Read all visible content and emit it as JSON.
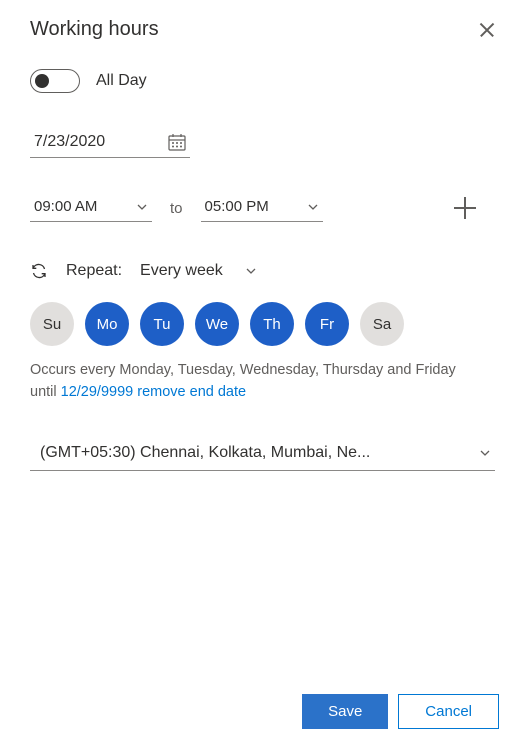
{
  "title": "Working hours",
  "allDay": {
    "label": "All Day",
    "on": false
  },
  "date": "7/23/2020",
  "time": {
    "from": "09:00 AM",
    "to_label": "to",
    "to": "05:00 PM"
  },
  "repeat": {
    "label": "Repeat:",
    "value": "Every week"
  },
  "days": [
    {
      "abbr": "Su",
      "active": false
    },
    {
      "abbr": "Mo",
      "active": true
    },
    {
      "abbr": "Tu",
      "active": true
    },
    {
      "abbr": "We",
      "active": true
    },
    {
      "abbr": "Th",
      "active": true
    },
    {
      "abbr": "Fr",
      "active": true
    },
    {
      "abbr": "Sa",
      "active": false
    }
  ],
  "occursText": "Occurs every Monday, Tuesday, Wednesday, Thursday and Friday",
  "until": {
    "prefix": "until",
    "date": "12/29/9999",
    "remove_label": "remove end date"
  },
  "timezone": "(GMT+05:30) Chennai, Kolkata, Mumbai, Ne...",
  "buttons": {
    "save": "Save",
    "cancel": "Cancel"
  }
}
